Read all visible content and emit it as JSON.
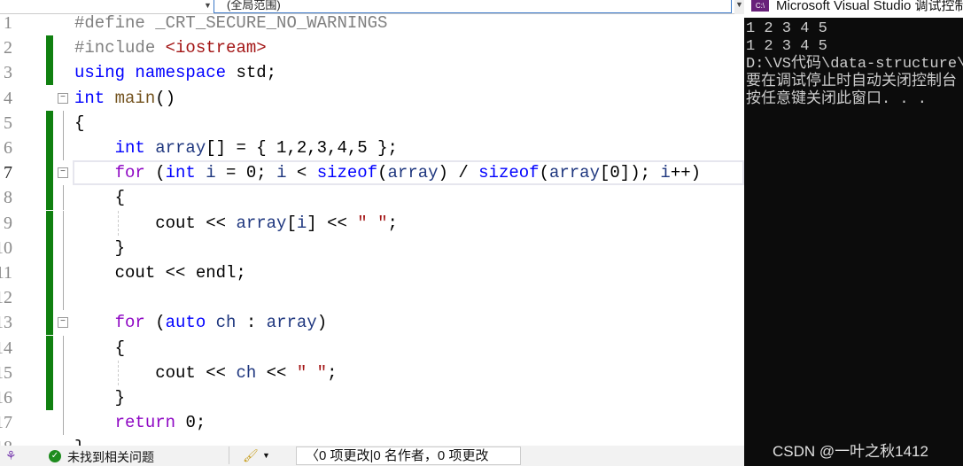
{
  "topbar": {
    "scope": "(全局范围)"
  },
  "editor": {
    "current_line": 7,
    "lines": [
      {
        "n": "1",
        "changed": false,
        "fold": false,
        "indent": 0,
        "tokens": [
          [
            "#define _CRT_SECURE_NO_WARNINGS",
            "pp"
          ]
        ]
      },
      {
        "n": "2",
        "changed": true,
        "fold": false,
        "indent": 0,
        "tokens": [
          [
            "#include ",
            "pp"
          ],
          [
            "<iostream>",
            "inc"
          ]
        ]
      },
      {
        "n": "3",
        "changed": true,
        "fold": false,
        "indent": 0,
        "tokens": [
          [
            "using namespace ",
            "kw"
          ],
          [
            "std;",
            "pl"
          ]
        ]
      },
      {
        "n": "4",
        "changed": false,
        "fold": true,
        "indent": 0,
        "tokens": [
          [
            "int ",
            "kw"
          ],
          [
            "main",
            "fn"
          ],
          [
            "()",
            "pl"
          ]
        ]
      },
      {
        "n": "5",
        "changed": true,
        "fold": false,
        "indent": 0,
        "tokens": [
          [
            "{",
            "pl"
          ]
        ]
      },
      {
        "n": "6",
        "changed": true,
        "fold": false,
        "indent": 4,
        "tokens": [
          [
            "int ",
            "kw"
          ],
          [
            "array",
            "var"
          ],
          [
            "[] = { 1,2,3,4,5 };",
            "pl"
          ]
        ]
      },
      {
        "n": "7",
        "changed": true,
        "fold": true,
        "indent": 4,
        "tokens": [
          [
            "for ",
            "ctl"
          ],
          [
            "(",
            "pl"
          ],
          [
            "int ",
            "kw"
          ],
          [
            "i",
            "var"
          ],
          [
            " = 0; ",
            "pl"
          ],
          [
            "i",
            "var"
          ],
          [
            " < ",
            "pl"
          ],
          [
            "sizeof",
            "kw"
          ],
          [
            "(",
            "pl"
          ],
          [
            "array",
            "var"
          ],
          [
            ") / ",
            "pl"
          ],
          [
            "sizeof",
            "kw"
          ],
          [
            "(",
            "pl"
          ],
          [
            "array",
            "var"
          ],
          [
            "[0]); ",
            "pl"
          ],
          [
            "i",
            "var"
          ],
          [
            "++)",
            "pl"
          ]
        ]
      },
      {
        "n": "8",
        "changed": true,
        "fold": false,
        "indent": 4,
        "tokens": [
          [
            "{",
            "pl"
          ]
        ]
      },
      {
        "n": "9",
        "changed": true,
        "fold": false,
        "indent": 8,
        "tokens": [
          [
            "cout << ",
            "pl"
          ],
          [
            "array",
            "var"
          ],
          [
            "[",
            "pl"
          ],
          [
            "i",
            "var"
          ],
          [
            "] << ",
            "pl"
          ],
          [
            "\" \"",
            "str"
          ],
          [
            ";",
            "pl"
          ]
        ]
      },
      {
        "n": "10",
        "changed": true,
        "fold": false,
        "indent": 4,
        "tokens": [
          [
            "}",
            "pl"
          ]
        ]
      },
      {
        "n": "11",
        "changed": true,
        "fold": false,
        "indent": 4,
        "tokens": [
          [
            "cout << endl;",
            "pl"
          ]
        ]
      },
      {
        "n": "12",
        "changed": true,
        "fold": false,
        "indent": 0,
        "tokens": []
      },
      {
        "n": "13",
        "changed": true,
        "fold": true,
        "indent": 4,
        "tokens": [
          [
            "for ",
            "ctl"
          ],
          [
            "(",
            "pl"
          ],
          [
            "auto ",
            "kw"
          ],
          [
            "ch",
            "var"
          ],
          [
            " : ",
            "pl"
          ],
          [
            "array",
            "var"
          ],
          [
            ")",
            "pl"
          ]
        ]
      },
      {
        "n": "14",
        "changed": true,
        "fold": false,
        "indent": 4,
        "tokens": [
          [
            "{",
            "pl"
          ]
        ]
      },
      {
        "n": "15",
        "changed": true,
        "fold": false,
        "indent": 8,
        "tokens": [
          [
            "cout << ",
            "pl"
          ],
          [
            "ch",
            "var"
          ],
          [
            " << ",
            "pl"
          ],
          [
            "\" \"",
            "str"
          ],
          [
            ";",
            "pl"
          ]
        ]
      },
      {
        "n": "16",
        "changed": true,
        "fold": false,
        "indent": 4,
        "tokens": [
          [
            "}",
            "pl"
          ]
        ]
      },
      {
        "n": "17",
        "changed": false,
        "fold": false,
        "indent": 4,
        "tokens": [
          [
            "return ",
            "ctl"
          ],
          [
            "0;",
            "pl"
          ]
        ]
      },
      {
        "n": "18",
        "changed": false,
        "fold": false,
        "indent": 0,
        "tokens": [
          [
            "}",
            "pl"
          ]
        ]
      }
    ]
  },
  "status": {
    "issues": "未找到相关问题",
    "changes": "0 项更改|0 名作者，0 项更改"
  },
  "console": {
    "icon": "C:\\",
    "title": "Microsoft Visual Studio 调试控制台",
    "output": [
      "1 2 3 4 5",
      "1 2 3 4 5",
      "D:\\VS代码\\data-structure\\",
      "要在调试停止时自动关闭控制台",
      "按任意键关闭此窗口. . ."
    ],
    "watermark": "CSDN @一叶之秋1412"
  }
}
